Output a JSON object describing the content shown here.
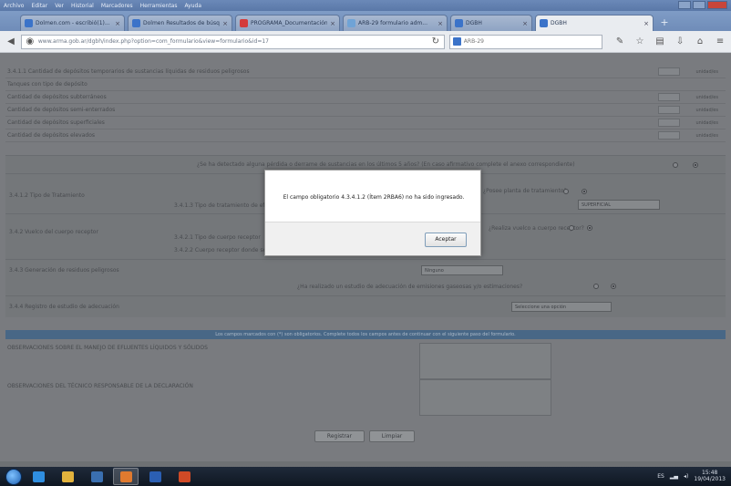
{
  "browser": {
    "menu": [
      "Archivo",
      "Editar",
      "Ver",
      "Historial",
      "Marcadores",
      "Herramientas",
      "Ayuda"
    ],
    "tabs": [
      {
        "label": "Dolmen.com - escribió(1)...",
        "icon": "doc-icon",
        "color": "#3b73c9"
      },
      {
        "label": "Dolmen Resultados de búsq...",
        "icon": "doc-icon",
        "color": "#3b73c9"
      },
      {
        "label": "PROGRAMA_Documentación...",
        "icon": "twitter-icon",
        "color": "#d43b3b"
      },
      {
        "label": "ARB-29 formulario adm...",
        "icon": "globe-icon",
        "color": "#6fa3d6"
      },
      {
        "label": "DGBH",
        "icon": "doc-icon",
        "color": "#3b73c9"
      },
      {
        "label": "DGBH",
        "icon": "doc-icon",
        "color": "#3b73c9"
      }
    ],
    "url": "www.arma.gob.ar/dgbh/index.php?option=com_formulario&view=formulario&id=17",
    "search_text": "ARB-29"
  },
  "form": {
    "rows": [
      "3.4.1.1 Cantidad de depósitos temporarios de sustancias líquidas de residuos peligrosos",
      "Tanques con tipo de depósito",
      "Cantidad de depósitos subterráneos",
      "Cantidad de depósitos semi-enterrados",
      "Cantidad de depósitos superficiales",
      "Cantidad de depósitos elevados"
    ],
    "unit_label": "unidad/es",
    "question_leak": "¿Se ha detectado alguna pérdida o derrame de sustancias en los últimos 5 años? (En caso afirmativo complete el anexo correspondiente)",
    "treatment_label": "3.4.1.2 Tipo de Tratamiento",
    "treatment_sub": "3.4.1.3 Tipo de tratamiento de efluentes",
    "treatment_question": "¿Posee planta de tratamiento?",
    "selected_option": "SUPERFICIAL",
    "vuelco_label": "3.4.2 Vuelco del cuerpo receptor",
    "vuelco_sub1": "3.4.2.1 Tipo de cuerpo receptor",
    "vuelco_sub2": "3.4.2.2 Cuerpo receptor donde se realiza el vertido de efluentes",
    "vuelco_question": "¿Realiza vuelco a cuerpo receptor?",
    "residuos_label": "3.4.3 Generación de residuos peligrosos",
    "residuos_select": "Ninguno",
    "adecuacion_question": "¿Ha realizado un estudio de adecuación de emisiones gaseosas y/o estimaciones?",
    "adecuacion_label": "3.4.4 Registro de estudio de adecuación",
    "adecuacion_select": "Seleccione una opción",
    "blue_bar": "Los campos marcados con (*) son obligatorios. Complete todos los campos antes de continuar con el siguiente paso del formulario.",
    "obs_label_1": "OBSERVACIONES SOBRE EL MANEJO DE EFLUENTES LÍQUIDOS Y SÓLIDOS",
    "obs_label_2": "OBSERVACIONES DEL TÉCNICO RESPONSABLE DE LA DECLARACIÓN",
    "save_button": "Registrar",
    "cancel_button": "Limpiar",
    "yes_label": "Sí",
    "no_label": "No"
  },
  "modal": {
    "message": "El campo obligatorio 4.3.4.1.2 (Ítem 2RBA6) no ha sido ingresado.",
    "ok_label": "Aceptar"
  },
  "taskbar": {
    "time": "15:48",
    "date": "19/04/2013",
    "lang": "ES"
  }
}
